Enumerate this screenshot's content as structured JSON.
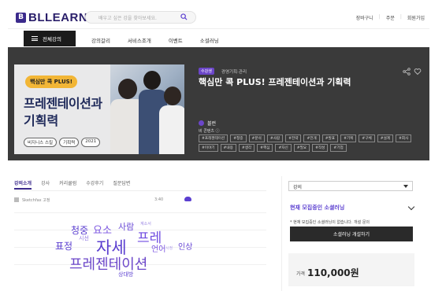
{
  "header": {
    "logo": "BLLEARN",
    "search_placeholder": "배우고 싶은 강을 찾아보세요.",
    "links": [
      "장바구니",
      "주문 ",
      "회원가입"
    ]
  },
  "nav": {
    "all_label": "전체강의",
    "items": [
      "강의갈리",
      "서비스조개",
      "이벤트",
      "소셜러닝"
    ]
  },
  "hero": {
    "badge": "수강생",
    "category": "경영기획·관리",
    "title": "핵심만 콕 PLUS! 프레젠테이션과 기획력",
    "thumb_tag": "핵심만 콕 PLUS!",
    "thumb_title_line1": "프레젠테이션과",
    "thumb_title_line2": "기획력",
    "thumb_chips": [
      "비지니스 스킬",
      "기획력",
      "2021"
    ],
    "author": "블런",
    "tags_label": "비 콘텐츠 ⓘ",
    "tags": [
      "#프레젠테이션",
      "#청중",
      "#분석",
      "#사람",
      "#전략",
      "#전개",
      "#발표",
      "#기획",
      "#구체",
      "#설계",
      "#회사",
      "#이야기",
      "#내용",
      "#생각",
      "#핵심",
      "#자신",
      "#필요",
      "#작성",
      "#기업"
    ]
  },
  "tabs": [
    "강의소개",
    "강사",
    "커리큘럼",
    "수강후기",
    "질문답변"
  ],
  "video": {
    "title": "Sketchfax 고정",
    "time": "3:40"
  },
  "word_cloud": {
    "words": [
      "청중",
      "요소",
      "사람",
      "계소서",
      "프레",
      "표정",
      "시선",
      "자세",
      "언어",
      "인상",
      "시정",
      "프레젠테이션",
      "상대방"
    ]
  },
  "sidebar": {
    "select_value": "강의",
    "section_title": "현재 모집중인 소셜러닝",
    "note": "* 현재 모집중인 소셜러닝이 없습니다. 개설 문의",
    "button": "소셜러닝 개설하기",
    "price_label": "가격",
    "price": "110,000원"
  },
  "colors": {
    "brand": "#3b2a8c",
    "accent": "#5b3fd0",
    "hero_bg": "#3a3a3a"
  }
}
